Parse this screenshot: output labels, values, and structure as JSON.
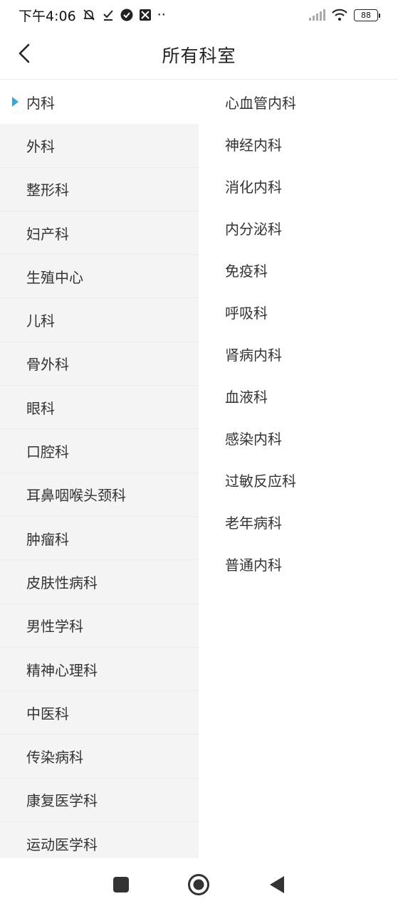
{
  "status_bar": {
    "time": "下午4:06",
    "more": "··",
    "battery": "88",
    "icons": [
      "mute-icon",
      "download-done-icon",
      "check-circle-icon",
      "app-icon",
      "signal-icon",
      "wifi-icon",
      "battery-icon"
    ]
  },
  "header": {
    "title": "所有科室",
    "back_icon": "chevron-left-icon"
  },
  "categories": [
    {
      "label": "内科",
      "active": true
    },
    {
      "label": "外科"
    },
    {
      "label": "整形科"
    },
    {
      "label": "妇产科"
    },
    {
      "label": "生殖中心"
    },
    {
      "label": "儿科"
    },
    {
      "label": "骨外科"
    },
    {
      "label": "眼科"
    },
    {
      "label": "口腔科"
    },
    {
      "label": "耳鼻咽喉头颈科"
    },
    {
      "label": "肿瘤科"
    },
    {
      "label": "皮肤性病科"
    },
    {
      "label": "男性学科"
    },
    {
      "label": "精神心理科"
    },
    {
      "label": "中医科"
    },
    {
      "label": "传染病科"
    },
    {
      "label": "康复医学科"
    },
    {
      "label": "运动医学科"
    }
  ],
  "subcategories": [
    {
      "label": "心血管内科"
    },
    {
      "label": "神经内科"
    },
    {
      "label": "消化内科"
    },
    {
      "label": "内分泌科"
    },
    {
      "label": "免疫科"
    },
    {
      "label": "呼吸科"
    },
    {
      "label": "肾病内科"
    },
    {
      "label": "血液科"
    },
    {
      "label": "感染内科"
    },
    {
      "label": "过敏反应科"
    },
    {
      "label": "老年病科"
    },
    {
      "label": "普通内科"
    }
  ],
  "nav_bar": {
    "icons": [
      "recents-icon",
      "home-icon",
      "back-icon"
    ]
  },
  "colors": {
    "accent": "#34a8d6",
    "left_bg": "#f4f4f4",
    "text": "#333333"
  }
}
